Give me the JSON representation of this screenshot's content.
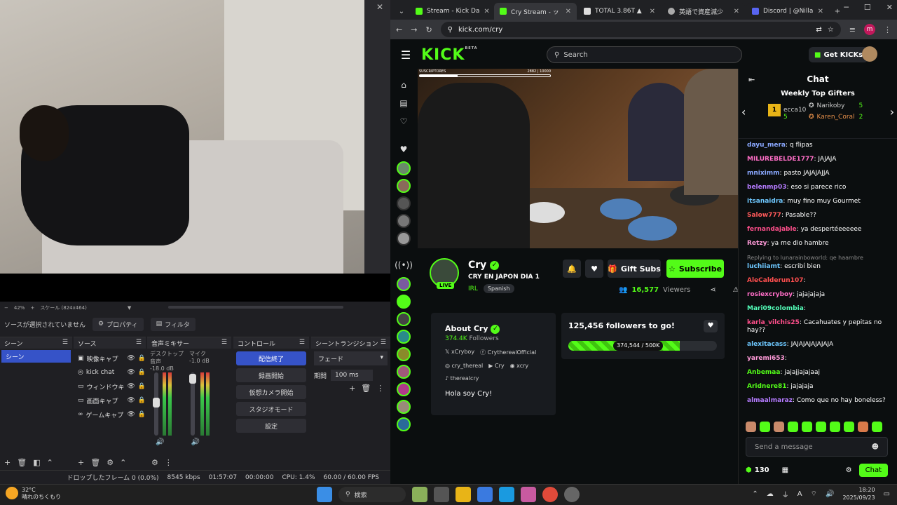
{
  "obs": {
    "scale_label": "42%",
    "scale_info": "スケール (824x464)",
    "no_source": "ソースが選択されていません",
    "properties_btn": "プロパティ",
    "filters_btn": "フィルタ",
    "docks": {
      "scenes": "シーン",
      "sources": "ソース",
      "mixer": "音声ミキサー",
      "controls": "コントロール",
      "transitions": "シーントランジション"
    },
    "scene_selected": "シーン",
    "sources": [
      "映像キャプ",
      "kick chat",
      "ウィンドウキ",
      "画面キャプ",
      "ゲームキャプ"
    ],
    "mixer": [
      {
        "name": "デスクトップ音声",
        "db": "-18.0 dB"
      },
      {
        "name": "マイク",
        "db": "-1.0 dB"
      }
    ],
    "controls": [
      "配信終了",
      "録画開始",
      "仮想カメラ開始",
      "スタジオモード",
      "設定"
    ],
    "transition": "フェード",
    "duration_label": "期間",
    "duration": "100 ms",
    "status": {
      "dropped": "ドロップしたフレーム 0 (0.0%)",
      "kbps": "8545 kbps",
      "live_time": "01:57:07",
      "rec_time": "00:00:00",
      "cpu": "CPU: 1.4%",
      "fps": "60.00 / 60.00 FPS"
    }
  },
  "browser": {
    "tabs": [
      {
        "title": "Stream - Kick Da",
        "color": "#53fc18"
      },
      {
        "title": "Cry Stream - ッ",
        "color": "#53fc18"
      },
      {
        "title": "TOTAL 3.86T ▲",
        "color": "#888888"
      },
      {
        "title": "英語で資産減少",
        "color": "#888888"
      },
      {
        "title": "Discord | @Nilla",
        "color": "#5865f2"
      }
    ],
    "url": "kick.com/cry",
    "profile_letter": "m"
  },
  "kick": {
    "logo": "KICK",
    "logo_beta": "BETA",
    "search_placeholder": "Search",
    "get_kicks": "Get KICKs",
    "video_overlay": {
      "label": "SUSCRIPTORES",
      "progress": "2882 | 10000",
      "fill_fraction": 0.29
    },
    "channel": {
      "name": "Cry",
      "live": "LIVE",
      "title": "CRY EN JAPON DIA 1",
      "category": "IRL",
      "language": "Spanish",
      "viewers": "16,577",
      "viewers_label": "Viewers"
    },
    "gift_subs": "Gift Subs",
    "subscribe": "Subscribe",
    "about": {
      "title": "About Cry",
      "followers": "374.4K",
      "followers_label": "Followers",
      "socials": [
        "xCryboy",
        "CrytherealOfficial",
        "cry_thereal",
        "Cry",
        "xcry",
        "therealcry"
      ],
      "bio": "Hola soy Cry!"
    },
    "goal": {
      "title": "125,456 followers to go!",
      "progress": "374,544 / 500K",
      "fraction": 0.749
    }
  },
  "chat": {
    "title": "Chat",
    "gifters_title": "Weekly Top Gifters",
    "gifters": [
      {
        "name": "ecca10",
        "count": "5",
        "rank": "1"
      },
      {
        "name": "Narikoby",
        "count": "5"
      },
      {
        "name": "Karen_Coral",
        "count": "2"
      }
    ],
    "messages": [
      {
        "user": "dayu_mera",
        "color": "#8aa8ff",
        "text": "q flipas"
      },
      {
        "user": "MILUREBELDE1777",
        "color": "#ff6ec7",
        "text": "JAJAJA"
      },
      {
        "user": "mniximm",
        "color": "#8aa8ff",
        "text": "pasto JAJAJAJJA"
      },
      {
        "user": "belenmp03",
        "color": "#b57bff",
        "text": "eso si parece rico"
      },
      {
        "user": "itsanaidra",
        "color": "#6ec8ff",
        "text": "muy fino muy Gourmet"
      },
      {
        "user": "Salow777",
        "color": "#ff5a5a",
        "text": "Pasable??"
      },
      {
        "user": "fernandajable",
        "color": "#ff4f8b",
        "text": "ya despertéeeeeee"
      },
      {
        "user": "Retzy",
        "color": "#ff9ad8",
        "text": "ya me dio hambre"
      },
      {
        "user": "luchiiamt",
        "color": "#6ec8ff",
        "text": "escribí bien",
        "reply": "Replying to lunarainboworld: qe haambre"
      },
      {
        "user": "AleCalderun107",
        "color": "#ff4f4f",
        "text": ""
      },
      {
        "user": "rosiexcryboy",
        "color": "#ff6ec7",
        "text": "jajajajaja"
      },
      {
        "user": "Mari09colombia",
        "color": "#53fcb8",
        "text": ""
      },
      {
        "user": "karla_vilchis25",
        "color": "#ff4f8b",
        "text": "Cacahuates y pepitas no hay??"
      },
      {
        "user": "alexitacass",
        "color": "#6ec8ff",
        "text": "JAJAJAJAJAJAJA"
      },
      {
        "user": "yaremi653",
        "color": "#ff9ad8",
        "text": ""
      },
      {
        "user": "Anbemaa",
        "color": "#53fc18",
        "text": "jajajjajajaaj"
      },
      {
        "user": "Aridnere81",
        "color": "#53fc18",
        "text": "jajajaja"
      },
      {
        "user": "almaalmaraz",
        "color": "#b57bff",
        "text": "Como que no hay boneless?"
      }
    ],
    "input_placeholder": "Send a message",
    "points": "130",
    "send": "Chat"
  },
  "taskbar": {
    "temp": "32°C",
    "weather": "晴れのちくもり",
    "search": "検索",
    "time": "18:20",
    "date": "2025/09/23"
  }
}
